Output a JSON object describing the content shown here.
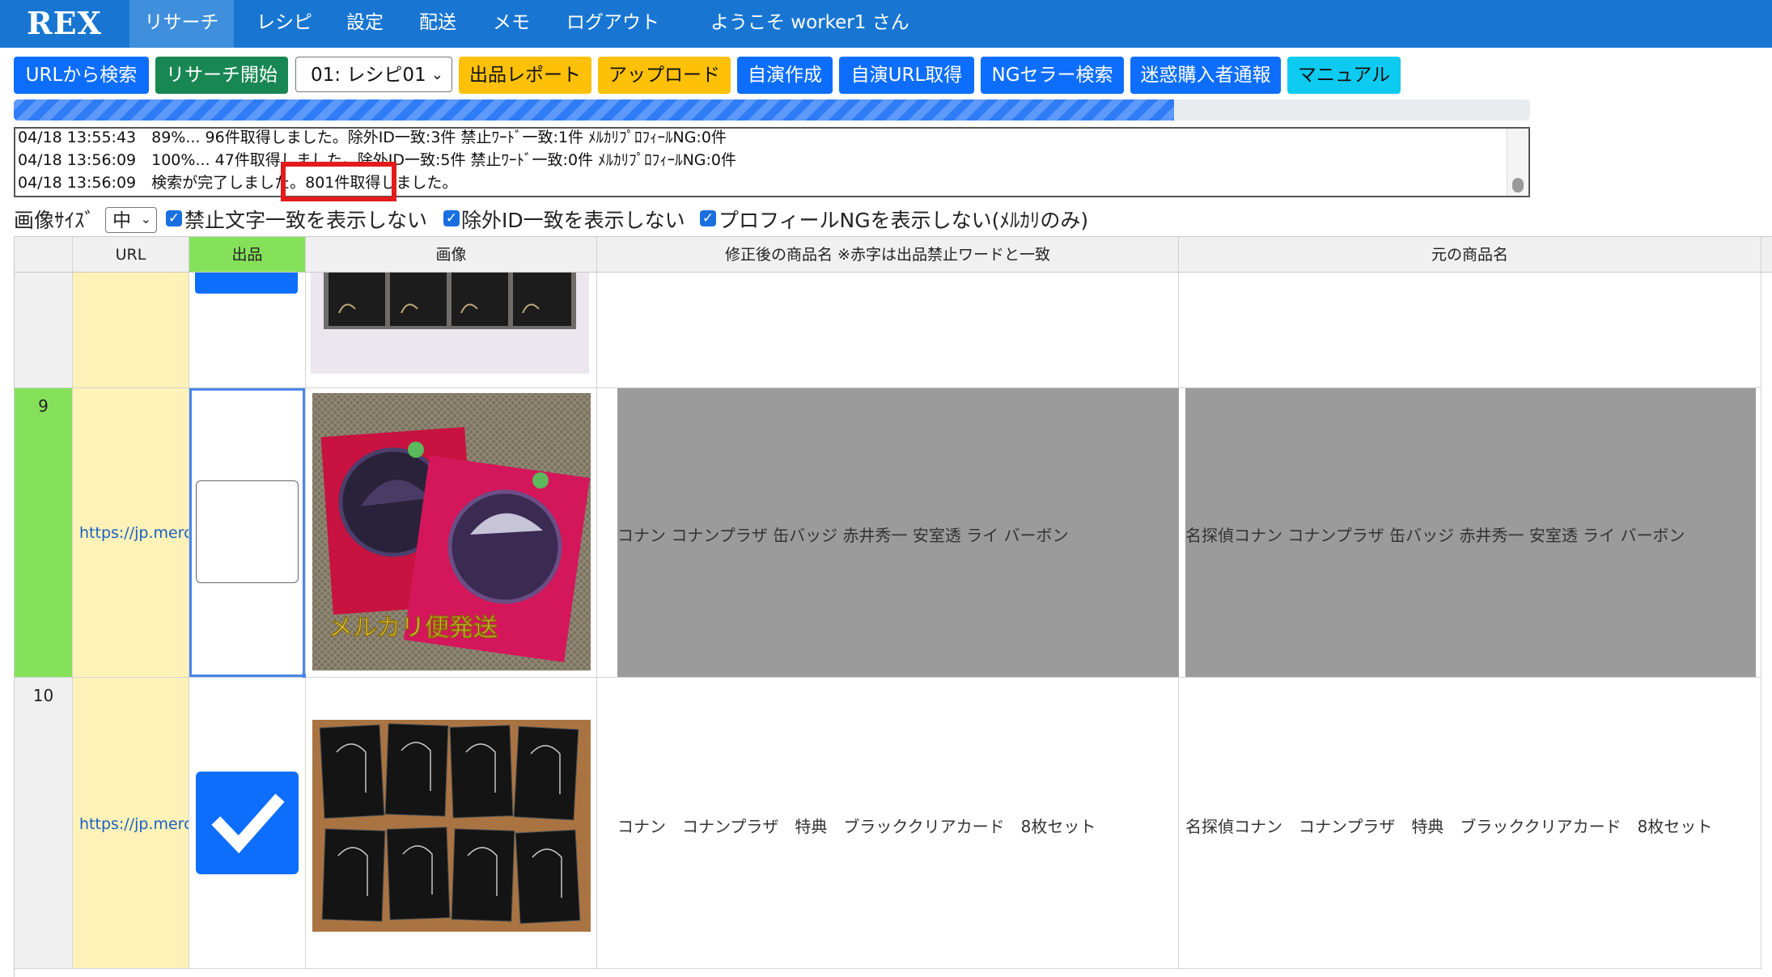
{
  "nav": {
    "logo": "REX",
    "items": [
      {
        "label": "リサーチ",
        "active": true
      },
      {
        "label": "レシピ"
      },
      {
        "label": "設定"
      },
      {
        "label": "配送"
      },
      {
        "label": "メモ"
      },
      {
        "label": "ログアウト"
      }
    ],
    "welcome": "ようこそ worker1 さん"
  },
  "toolbar": {
    "url_search": "URLから検索",
    "research_start": "リサーチ開始",
    "recipe_select": "01: レシピ01",
    "listing_report": "出品レポート",
    "upload": "アップロード",
    "self_create": "自演作成",
    "self_url": "自演URL取得",
    "ng_seller": "NGセラー検索",
    "nuisance_report": "迷惑購入者通報",
    "manual": "マニュアル"
  },
  "progress": {
    "percent": 76.5
  },
  "log": {
    "lines": [
      "04/18 13:55:43　89%... 96件取得しました。除外ID一致:3件 禁止ﾜｰﾄﾞ一致:1件 ﾒﾙｶﾘﾌﾟﾛﾌｨｰﾙNG:0件",
      "04/18 13:56:09　100%... 47件取得しました。除外ID一致:5件 禁止ﾜｰﾄﾞ一致:0件 ﾒﾙｶﾘﾌﾟﾛﾌｨｰﾙNG:0件",
      "04/18 13:56:09　検索が完了しました。801件取得しました。"
    ]
  },
  "filters": {
    "image_size_label": "画像ｻｲｽﾞ",
    "image_size_value": "中",
    "hide_banned_words": "禁止文字一致を表示しない",
    "hide_excluded_id": "除外ID一致を表示しない",
    "hide_profile_ng": "プロフィールNGを表示しない(ﾒﾙｶﾘのみ)"
  },
  "table": {
    "headers": {
      "num": "",
      "url": "URL",
      "listing": "出品",
      "image": "画像",
      "edited_name": "修正後の商品名 ※赤字は出品禁止ワードと一致",
      "original_name": "元の商品名"
    },
    "rows": [
      {
        "num": "",
        "url": "",
        "checked": null,
        "edited_name": "",
        "original_name": ""
      },
      {
        "num": "9",
        "url": "https://jp.merc",
        "checked": false,
        "image_caption": "メルカリ便発送",
        "edited_name": "コナン コナンプラザ 缶バッジ 赤井秀一 安室透 ライ バーボン",
        "original_name": "名探偵コナン コナンプラザ 缶バッジ 赤井秀一 安室透 ライ バーボン"
      },
      {
        "num": "10",
        "url": "https://jp.merc",
        "checked": true,
        "edited_name": "コナン　コナンプラザ　特典　ブラッククリアカード　8枚セット",
        "original_name": "名探偵コナン　コナンプラザ　特典　ブラッククリアカード　8枚セット"
      }
    ]
  }
}
